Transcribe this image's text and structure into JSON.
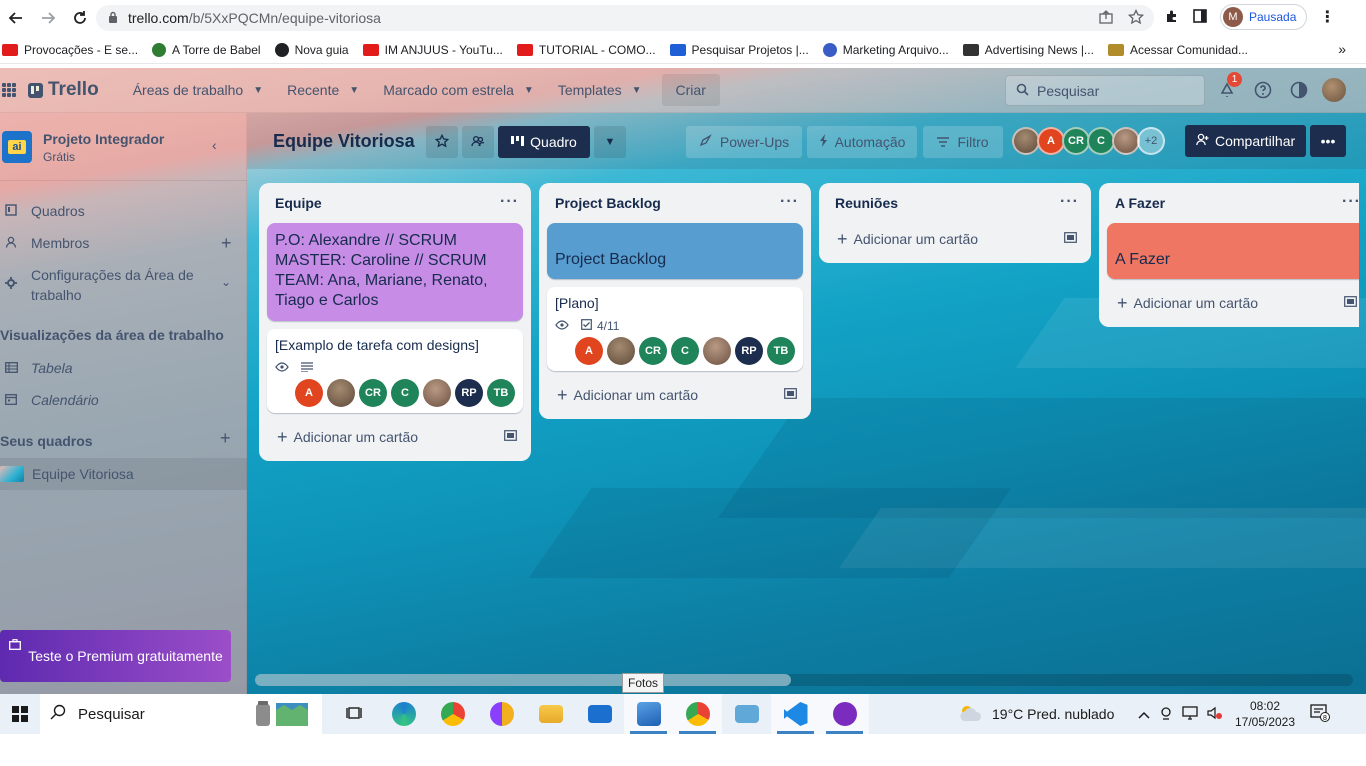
{
  "browser": {
    "url_host": "trello.com",
    "url_path": "/b/5XxPQCMn/equipe-vitoriosa",
    "profile_initial": "M",
    "profile_status": "Pausada",
    "bookmarks": [
      {
        "label": "Provocações - E se...",
        "color": "#e21b1b"
      },
      {
        "label": "A Torre de Babel",
        "color": "#2e7d32"
      },
      {
        "label": "Nova guia",
        "color": "#202124"
      },
      {
        "label": "IM ANJUUS - YouTu...",
        "color": "#e21b1b"
      },
      {
        "label": "TUTORIAL - COMO...",
        "color": "#e21b1b"
      },
      {
        "label": "Pesquisar Projetos |...",
        "color": "#1e5fd6"
      },
      {
        "label": "Marketing Arquivo...",
        "color": "#3a5cc6"
      },
      {
        "label": "Advertising News |...",
        "color": "#333333"
      },
      {
        "label": "Acessar Comunidad...",
        "color": "#b08d2a"
      }
    ],
    "more_label": "»"
  },
  "topnav": {
    "logo": "Trello",
    "menu": [
      {
        "label": "Áreas de trabalho"
      },
      {
        "label": "Recente"
      },
      {
        "label": "Marcado com estrela"
      },
      {
        "label": "Templates"
      }
    ],
    "create_label": "Criar",
    "search_placeholder": "Pesquisar",
    "notifications_count": "1"
  },
  "sidebar": {
    "workspace_name": "Projeto Integrador",
    "workspace_plan": "Grátis",
    "workspace_logo_text": "ai",
    "items": [
      {
        "label": "Quadros",
        "icon": "board-icon"
      },
      {
        "label": "Membros",
        "icon": "person-icon"
      },
      {
        "label": "Configurações da Área de trabalho",
        "icon": "gear-icon"
      }
    ],
    "views_heading": "Visualizações da área de trabalho",
    "views": [
      {
        "label": "Tabela",
        "icon": "table-icon"
      },
      {
        "label": "Calendário",
        "icon": "calendar-icon"
      }
    ],
    "boards_heading": "Seus quadros",
    "boards": [
      {
        "label": "Equipe Vitoriosa"
      }
    ],
    "premium_label": "Teste o Premium gratuitamente"
  },
  "board": {
    "title": "Equipe Vitoriosa",
    "view_label": "Quadro",
    "powerups_label": "Power-Ups",
    "automation_label": "Automação",
    "filter_label": "Filtro",
    "members": [
      {
        "initials": "",
        "color": "#7a6450"
      },
      {
        "initials": "A",
        "color": "#e0451f"
      },
      {
        "initials": "CR",
        "color": "#1f845a"
      },
      {
        "initials": "C",
        "color": "#1f845a"
      },
      {
        "initials": "",
        "color": "#8a6a56"
      }
    ],
    "extra_members": "+2",
    "share_label": "Compartilhar"
  },
  "lists": [
    {
      "title": "Equipe",
      "cover_card": {
        "text": "P.O: Alexandre // SCRUM MASTER: Caroline // SCRUM TEAM: Ana, Mariane, Renato, Tiago e Carlos",
        "color": "#c68ce6"
      },
      "card": {
        "text": "[Examplo de tarefa com designs]",
        "checklist": ""
      },
      "add_label": "Adicionar um cartão"
    },
    {
      "title": "Project Backlog",
      "cover_card": {
        "text": "Project Backlog",
        "color": "#579dcf"
      },
      "card": {
        "text": "[Plano]",
        "checklist": "4/11"
      },
      "add_label": "Adicionar um cartão"
    },
    {
      "title": "Reuniões",
      "add_label": "Adicionar um cartão"
    },
    {
      "title": "A Fazer",
      "cover_card": {
        "text": "A Fazer",
        "color": "#f07664"
      },
      "add_label": "Adicionar um cartão"
    }
  ],
  "card_members": [
    {
      "initials": "A",
      "color": "#e0451f"
    },
    {
      "initials": "",
      "color": "#7c6a55"
    },
    {
      "initials": "CR",
      "color": "#1f845a"
    },
    {
      "initials": "C",
      "color": "#1f845a"
    },
    {
      "initials": "",
      "color": "#8a6a56"
    },
    {
      "initials": "RP",
      "color": "#1d2d4e"
    },
    {
      "initials": "TB",
      "color": "#1f845a"
    }
  ],
  "tooltip": "Fotos",
  "taskbar": {
    "search_placeholder": "Pesquisar",
    "weather": "19°C  Pred. nublado",
    "time": "08:02",
    "date": "17/05/2023",
    "notif_count": "8"
  }
}
